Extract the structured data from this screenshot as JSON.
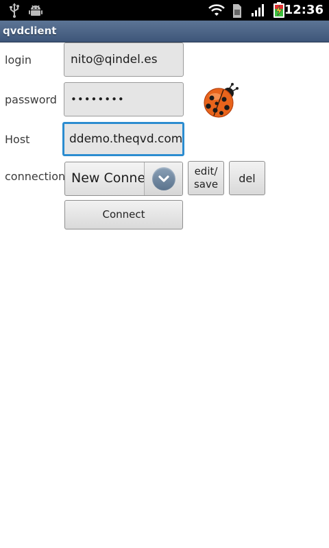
{
  "status_bar": {
    "time": "12:36",
    "left_icons": [
      "usb-icon",
      "android-debug-icon"
    ],
    "right_icons": [
      "wifi-icon",
      "sim-card-icon",
      "signal-strength-icon",
      "battery-charging-icon"
    ]
  },
  "app": {
    "title": "qvdclient"
  },
  "form": {
    "login_label": "login",
    "login_value": "nito@qindel.es",
    "password_label": "password",
    "password_value": "••••••••",
    "host_label": "Host",
    "host_value": "ddemo.theqvd.com",
    "connection_label": "connection",
    "connection_selected": "New Connection",
    "edit_save_label_line1": "edit/",
    "edit_save_label_line2": "save",
    "del_label": "del",
    "connect_label": "Connect"
  },
  "logo_icon": "ladybug-icon",
  "colors": {
    "title_bar": "#4a6587",
    "focus_border": "#2b8cd0",
    "ladybug": "#e8641c"
  }
}
